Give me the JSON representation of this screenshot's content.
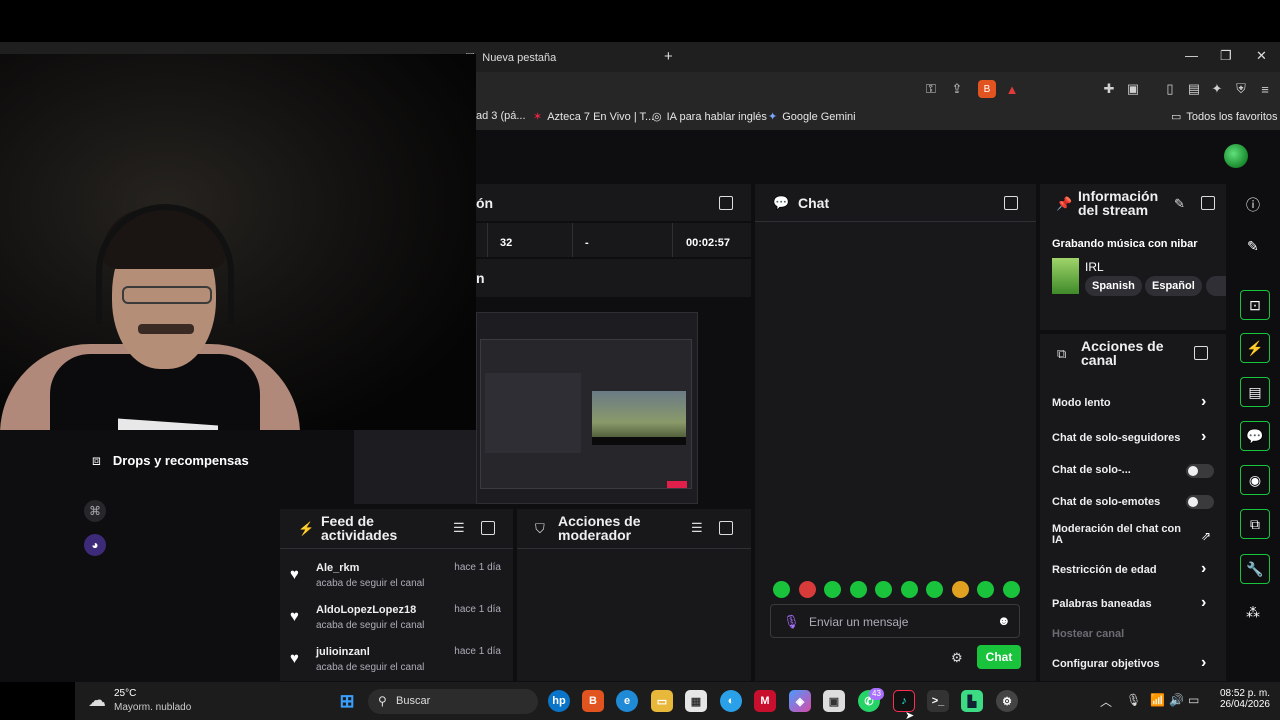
{
  "browser": {
    "tab_title": "Nueva pestaña",
    "new_tab_symbol": "+",
    "bookmarks": [
      {
        "label": "ad 3 (pá..."
      },
      {
        "label": "Azteca 7 En Vivo | T..."
      },
      {
        "label": "IA para hablar inglés"
      },
      {
        "label": "Google Gemini"
      }
    ],
    "all_bookmarks": "Todos los favoritos"
  },
  "dashboard": {
    "session_panel": {
      "title_fragment": "ón",
      "stats": [
        "32",
        "-",
        "00:02:57"
      ],
      "second_fragment": "n"
    },
    "left_nav": {
      "drops_label": "Drops y recompensas"
    },
    "feed": {
      "title": "Feed de actividades",
      "items": [
        {
          "name": "Ale_rkm",
          "text": "acaba de seguir el canal",
          "time": "hace 1 día"
        },
        {
          "name": "AldoLopezLopez18",
          "text": "acaba de seguir el canal",
          "time": "hace 1 día"
        },
        {
          "name": "julioinzanl",
          "text": "acaba de seguir el canal",
          "time": "hace 1 día"
        }
      ]
    },
    "mod_actions": {
      "title": "Acciones de moderador"
    },
    "chat": {
      "title": "Chat",
      "input_placeholder": "Enviar un mensaje",
      "send_label": "Chat",
      "emote_colors": [
        "#19c33b",
        "#d93b3b",
        "#19c33b",
        "#19c33b",
        "#19c33b",
        "#19c33b",
        "#19c33b",
        "#e0a020",
        "#19c33b",
        "#19c33b"
      ]
    },
    "stream_info": {
      "title": "Información del stream",
      "stream_title": "Grabando música con nibar",
      "category": "IRL",
      "tags": [
        "Spanish",
        "Español"
      ]
    },
    "channel_actions": {
      "title": "Acciones de canal",
      "items": [
        {
          "label": "Modo lento",
          "control": "chevron"
        },
        {
          "label": "Chat de solo-seguidores",
          "control": "chevron"
        },
        {
          "label": "Chat de solo-...",
          "control": "toggle"
        },
        {
          "label": "Chat de solo-emotes",
          "control": "toggle"
        },
        {
          "label": "Moderación del chat con IA",
          "control": "external"
        },
        {
          "label": "Restricción de edad",
          "control": "chevron"
        },
        {
          "label": "Palabras baneadas",
          "control": "chevron"
        },
        {
          "label": "Hostear canal",
          "control": "none"
        },
        {
          "label": "Configurar objetivos",
          "control": "chevron"
        }
      ]
    }
  },
  "taskbar": {
    "weather_temp": "25°C",
    "weather_desc": "Mayorm. nublado",
    "search_label": "Buscar",
    "whatsapp_badge": "43",
    "time": "08:52 p. m.",
    "date": "26/04/2026"
  },
  "colors": {
    "accent": "#19c33b",
    "panel": "#18181b",
    "bg": "#0e0e10"
  }
}
